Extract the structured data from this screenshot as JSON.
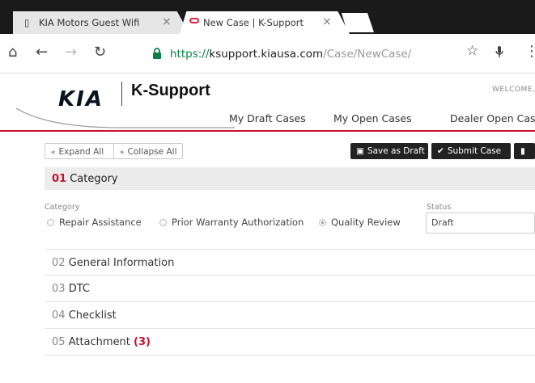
{
  "browser": {
    "tabs": [
      {
        "label": "KIA Motors Guest Wifi",
        "close": "×"
      },
      {
        "label": "New Case | K-Support",
        "close": "×"
      }
    ],
    "url": {
      "protocol": "https://",
      "host": "ksupport.kiausa.com",
      "path": "/Case/NewCase/"
    },
    "colors": {
      "secure": "#0b8043",
      "tabstrip": "#1a1a1a"
    }
  },
  "header": {
    "logo_text": "KIA",
    "brand": "K-Support",
    "welcome": "WELCOME,",
    "nav": [
      "My Draft Cases",
      "My Open Cases",
      "Dealer Open Cases"
    ],
    "accent": "#c8102e"
  },
  "toolbar": {
    "expand_all": "Expand All",
    "collapse_all": "Collapse All",
    "save_draft": "Save as Draft",
    "submit_case": "Submit Case"
  },
  "category": {
    "num": "01",
    "title": "Category",
    "field_label": "Category",
    "options": [
      "Repair Assistance",
      "Prior Warranty Authorization",
      "Quality Review"
    ],
    "selected": "Quality Review",
    "status_label": "Status",
    "status_value": "Draft"
  },
  "sections": [
    {
      "num": "02",
      "title": "General Information"
    },
    {
      "num": "03",
      "title": "DTC"
    },
    {
      "num": "04",
      "title": "Checklist"
    },
    {
      "num": "05",
      "title": "Attachment",
      "count": "(3)"
    }
  ]
}
